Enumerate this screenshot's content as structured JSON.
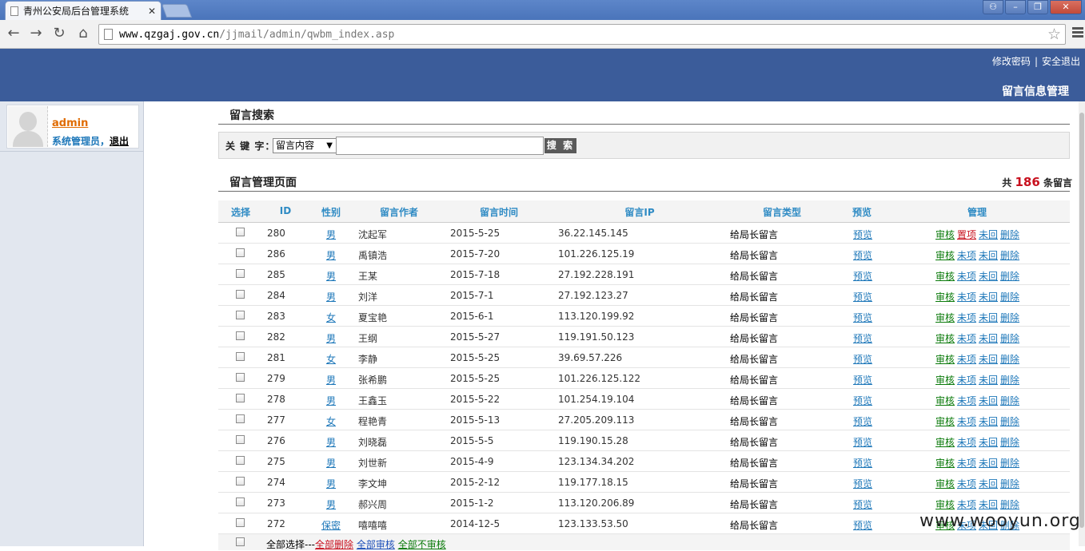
{
  "browser": {
    "tab_title": "青州公安局后台管理系统",
    "url_host": "www.qzgaj.gov.cn",
    "url_path": "/jjmail/admin/qwbm_index.asp"
  },
  "header": {
    "change_password": "修改密码",
    "separator": "|",
    "logout": "安全退出",
    "page_title": "留言信息管理"
  },
  "sidebar": {
    "username": "admin",
    "role": "系统管理员",
    "comma": "，",
    "logout": "退出"
  },
  "search": {
    "title": "留言搜索",
    "keyword_label": "关 键 字：",
    "select_value": "留言内容",
    "input_value": "",
    "button_label": "搜 索"
  },
  "manage": {
    "title": "留言管理页面",
    "total_prefix": "共",
    "total_count": "186",
    "total_suffix": "条留言"
  },
  "table": {
    "headers": {
      "select": "选择",
      "id": "ID",
      "gender": "性别",
      "author": "留言作者",
      "time": "留言时间",
      "ip": "留言IP",
      "type": "留言类型",
      "preview": "预览",
      "actions": "管理"
    },
    "rows": [
      {
        "id": "280",
        "gender": "男",
        "author": "沈起军",
        "time": "2015-5-25",
        "ip": "36.22.145.145",
        "type": "给局长留言",
        "preview": "预览",
        "a1": "审核",
        "a2": "置项",
        "a3": "未回",
        "a4": "删除",
        "top": true
      },
      {
        "id": "286",
        "gender": "男",
        "author": "禹镇浩",
        "time": "2015-7-20",
        "ip": "101.226.125.19",
        "type": "给局长留言",
        "preview": "预览",
        "a1": "审核",
        "a2": "未项",
        "a3": "未回",
        "a4": "删除"
      },
      {
        "id": "285",
        "gender": "男",
        "author": "王某",
        "time": "2015-7-18",
        "ip": "27.192.228.191",
        "type": "给局长留言",
        "preview": "预览",
        "a1": "审核",
        "a2": "未项",
        "a3": "未回",
        "a4": "删除"
      },
      {
        "id": "284",
        "gender": "男",
        "author": "刘洋",
        "time": "2015-7-1",
        "ip": "27.192.123.27",
        "type": "给局长留言",
        "preview": "预览",
        "a1": "审核",
        "a2": "未项",
        "a3": "未回",
        "a4": "删除"
      },
      {
        "id": "283",
        "gender": "女",
        "author": "夏宝艳",
        "time": "2015-6-1",
        "ip": "113.120.199.92",
        "type": "给局长留言",
        "preview": "预览",
        "a1": "审核",
        "a2": "未项",
        "a3": "未回",
        "a4": "删除"
      },
      {
        "id": "282",
        "gender": "男",
        "author": "王纲",
        "time": "2015-5-27",
        "ip": "119.191.50.123",
        "type": "给局长留言",
        "preview": "预览",
        "a1": "审核",
        "a2": "未项",
        "a3": "未回",
        "a4": "删除"
      },
      {
        "id": "281",
        "gender": "女",
        "author": "李静",
        "time": "2015-5-25",
        "ip": "39.69.57.226",
        "type": "给局长留言",
        "preview": "预览",
        "a1": "审核",
        "a2": "未项",
        "a3": "未回",
        "a4": "删除"
      },
      {
        "id": "279",
        "gender": "男",
        "author": "张希鹏",
        "time": "2015-5-25",
        "ip": "101.226.125.122",
        "type": "给局长留言",
        "preview": "预览",
        "a1": "审核",
        "a2": "未项",
        "a3": "未回",
        "a4": "删除"
      },
      {
        "id": "278",
        "gender": "男",
        "author": "王鑫玉",
        "time": "2015-5-22",
        "ip": "101.254.19.104",
        "type": "给局长留言",
        "preview": "预览",
        "a1": "审核",
        "a2": "未项",
        "a3": "未回",
        "a4": "删除"
      },
      {
        "id": "277",
        "gender": "女",
        "author": "程艳青",
        "time": "2015-5-13",
        "ip": "27.205.209.113",
        "type": "给局长留言",
        "preview": "预览",
        "a1": "审核",
        "a2": "未项",
        "a3": "未回",
        "a4": "删除"
      },
      {
        "id": "276",
        "gender": "男",
        "author": "刘晓磊",
        "time": "2015-5-5",
        "ip": "119.190.15.28",
        "type": "给局长留言",
        "preview": "预览",
        "a1": "审核",
        "a2": "未项",
        "a3": "未回",
        "a4": "删除"
      },
      {
        "id": "275",
        "gender": "男",
        "author": "刘世新",
        "time": "2015-4-9",
        "ip": "123.134.34.202",
        "type": "给局长留言",
        "preview": "预览",
        "a1": "审核",
        "a2": "未项",
        "a3": "未回",
        "a4": "删除"
      },
      {
        "id": "274",
        "gender": "男",
        "author": "李文坤",
        "time": "2015-2-12",
        "ip": "119.177.18.15",
        "type": "给局长留言",
        "preview": "预览",
        "a1": "审核",
        "a2": "未项",
        "a3": "未回",
        "a4": "删除"
      },
      {
        "id": "273",
        "gender": "男",
        "author": "郝兴周",
        "time": "2015-1-2",
        "ip": "113.120.206.89",
        "type": "给局长留言",
        "preview": "预览",
        "a1": "审核",
        "a2": "未项",
        "a3": "未回",
        "a4": "删除"
      },
      {
        "id": "272",
        "gender": "保密",
        "author": "嘻嘻嘻",
        "time": "2014-12-5",
        "ip": "123.133.53.50",
        "type": "给局长留言",
        "preview": "预览",
        "a1": "审核",
        "a2": "未项",
        "a3": "未回",
        "a4": "删除"
      }
    ],
    "footer": {
      "select_all": "全部选择---",
      "delete_all": "全部删除",
      "approve_all": "全部审核",
      "unapprove_all": "全部不审核"
    }
  },
  "watermark": "www.wooyun.org",
  "colors": {
    "header_bg": "#3b5c9a",
    "link_blue": "#1d77b9",
    "approve_green": "#0a7a0a",
    "highlight_red": "#c8101e"
  }
}
